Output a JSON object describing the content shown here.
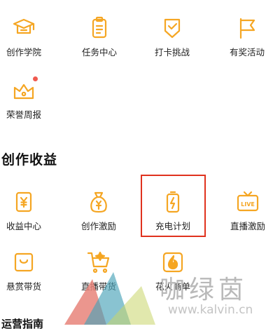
{
  "row1": [
    {
      "label": "创作学院",
      "icon": "graduation-cap-icon"
    },
    {
      "label": "任务中心",
      "icon": "clipboard-icon"
    },
    {
      "label": "打卡挑战",
      "icon": "shield-check-icon"
    },
    {
      "label": "有奖活动",
      "icon": "flag-icon"
    }
  ],
  "row2": [
    {
      "label": "荣誉周报",
      "icon": "crown-icon"
    }
  ],
  "section": {
    "title": "创作收益"
  },
  "row3": [
    {
      "label": "收益中心",
      "icon": "yuan-card-icon"
    },
    {
      "label": "创作激励",
      "icon": "money-bag-icon"
    },
    {
      "label": "充电计划",
      "icon": "battery-charge-icon"
    },
    {
      "label": "直播激励",
      "icon": "live-tv-icon"
    }
  ],
  "row4": [
    {
      "label": "悬赏带货",
      "icon": "shopping-bag-icon"
    },
    {
      "label": "直播带货",
      "icon": "shopping-cart-icon"
    },
    {
      "label": "花火商单",
      "icon": "flame-icon"
    }
  ],
  "bottom": {
    "title": "运营指南"
  },
  "watermark": {
    "name": "咖绿茵",
    "url": "www.kalvin.cn"
  },
  "colors": {
    "accent": "#f5a623",
    "badge": "#f05a4f",
    "highlight": "#e0321e"
  }
}
